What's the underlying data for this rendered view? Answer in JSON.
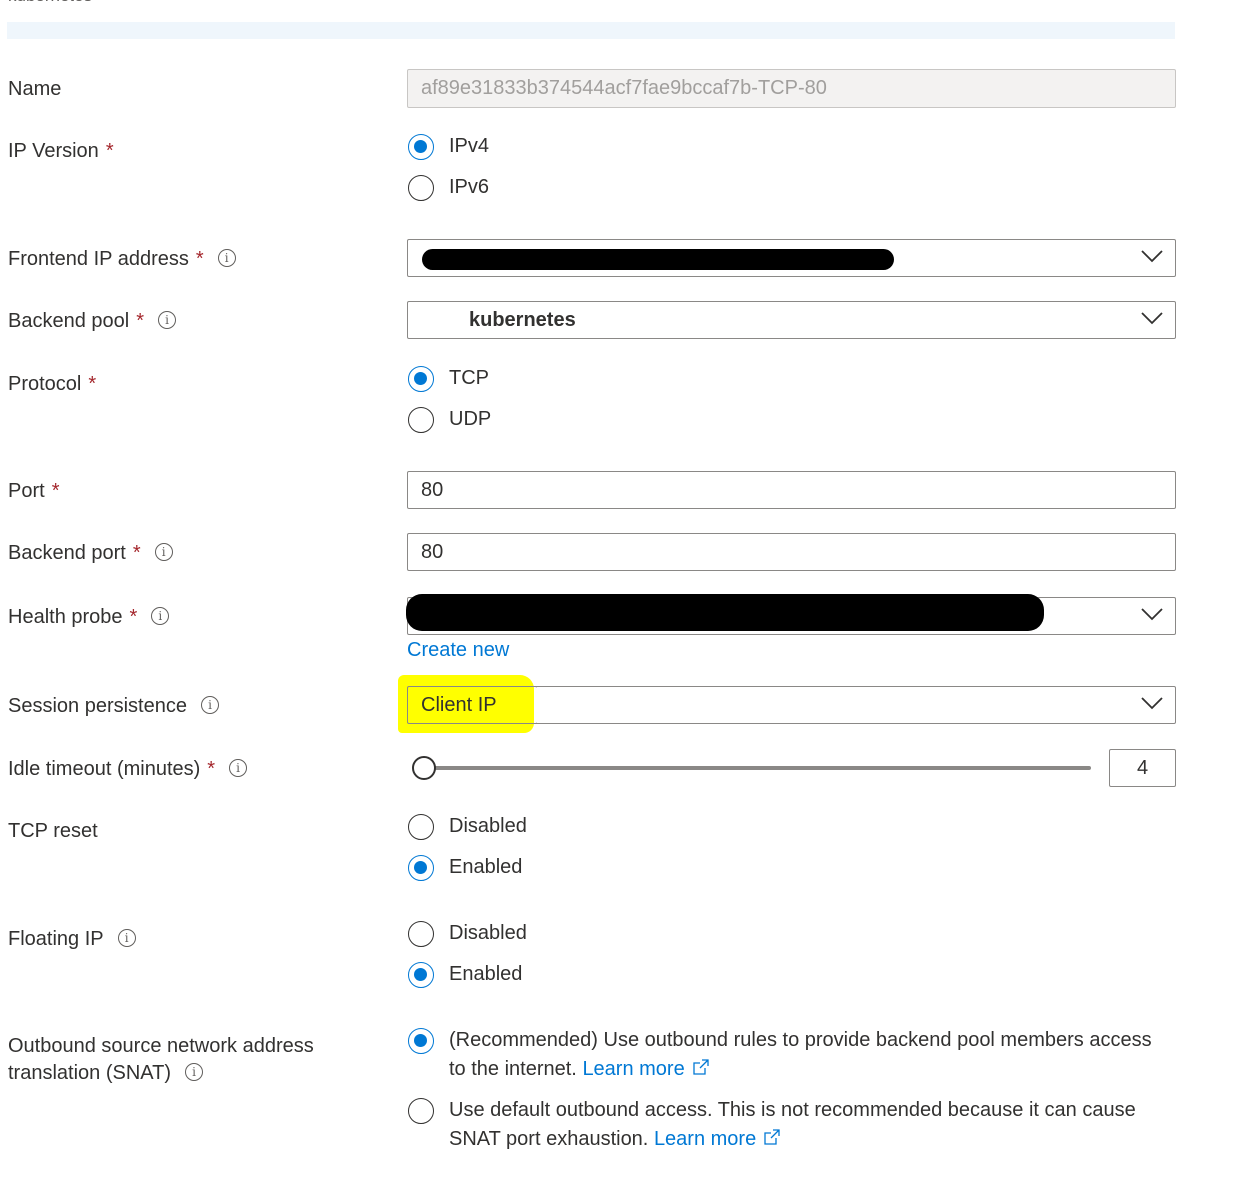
{
  "header": {
    "top_label": "kubernetes"
  },
  "fields": {
    "name": {
      "label": "Name",
      "value": "af89e31833b374544acf7fae9bccaf7b-TCP-80"
    },
    "ip_version": {
      "label": "IP Version",
      "required": "*",
      "options": [
        "IPv4",
        "IPv6"
      ],
      "selected": "IPv4"
    },
    "frontend_ip": {
      "label": "Frontend IP address",
      "required": "*",
      "value_redacted": true
    },
    "backend_pool": {
      "label": "Backend pool",
      "required": "*",
      "value": "kubernetes"
    },
    "protocol": {
      "label": "Protocol",
      "required": "*",
      "options": [
        "TCP",
        "UDP"
      ],
      "selected": "TCP"
    },
    "port": {
      "label": "Port",
      "required": "*",
      "value": "80"
    },
    "backend_port": {
      "label": "Backend port",
      "required": "*",
      "value": "80"
    },
    "health_probe": {
      "label": "Health probe",
      "required": "*",
      "value_redacted": true,
      "create_new": "Create new"
    },
    "session_persistence": {
      "label": "Session persistence",
      "value": "Client IP",
      "highlight_color": "#ffff00"
    },
    "idle_timeout": {
      "label": "Idle timeout (minutes)",
      "required": "*",
      "value": "4",
      "slider_fraction": 0
    },
    "tcp_reset": {
      "label": "TCP reset",
      "options": [
        "Disabled",
        "Enabled"
      ],
      "selected": "Enabled"
    },
    "floating_ip": {
      "label": "Floating IP",
      "options": [
        "Disabled",
        "Enabled"
      ],
      "selected": "Enabled"
    },
    "snat": {
      "label_line1": "Outbound source network address",
      "label_line2": "translation (SNAT)",
      "option1_text": "(Recommended) Use outbound rules to provide backend pool members access to the internet.",
      "option2_text": "Use default outbound access. This is not recommended because it can cause SNAT port exhaustion.",
      "learn_more": "Learn more",
      "selected_index": 0
    }
  },
  "icons": {
    "info": "info-icon",
    "chevron": "chevron-down-icon",
    "external": "external-link-icon"
  },
  "colors": {
    "accent": "#0078d4",
    "required": "#a4262c",
    "text": "#323130",
    "highlight": "#ffff00"
  }
}
